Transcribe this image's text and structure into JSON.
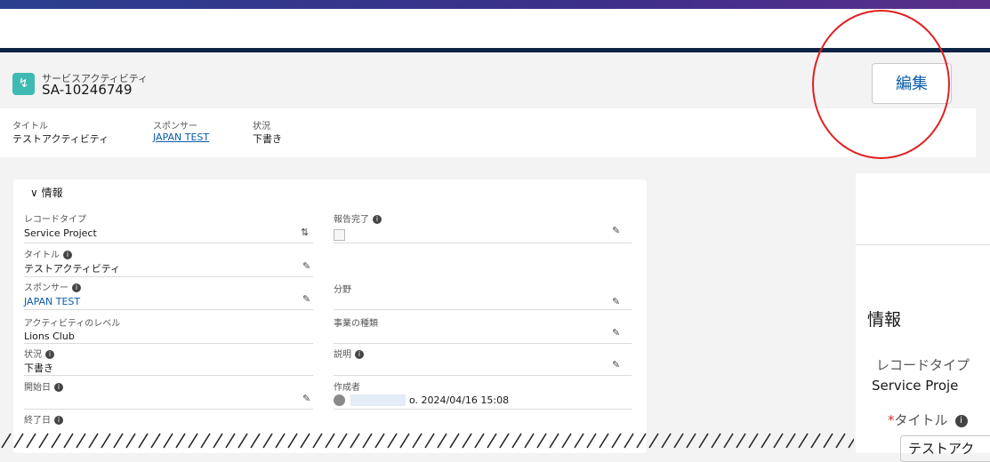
{
  "header": {
    "object_type": "サービスアクティビティ",
    "record_name": "SA-10246749",
    "fields": [
      {
        "label": "タイトル",
        "value": "テストアクティビティ"
      },
      {
        "label": "スポンサー",
        "value": "JAPAN TEST"
      },
      {
        "label": "状況",
        "value": "下書き"
      }
    ],
    "edit_label": "編集"
  },
  "details": {
    "section_title": "∨ 情報",
    "left": [
      {
        "label": "レコードタイプ",
        "value": "Service Project"
      },
      {
        "label": "タイトル",
        "value": "テストアクティビティ"
      },
      {
        "label": "スポンサー",
        "value": "JAPAN TEST"
      },
      {
        "label": "アクティビティのレベル",
        "value": "Lions Club"
      },
      {
        "label": "状況",
        "value": "下書き"
      },
      {
        "label": "開始日",
        "value": ""
      },
      {
        "label": "終了日",
        "value": ""
      }
    ],
    "right": [
      {
        "label": "報告完了",
        "value": ""
      },
      {
        "label": "分野",
        "value": ""
      },
      {
        "label": "事業の種類",
        "value": ""
      },
      {
        "label": "説明",
        "value": ""
      },
      {
        "label": "作成者",
        "value": "o. 2024/04/16 15:08"
      }
    ]
  },
  "zoom": {
    "section_title": "情報",
    "field1_label": "レコードタイプ",
    "field1_value": "Service Proje",
    "required_mark": "*",
    "field2_label": "タイトル",
    "field2_value": "テストアク"
  },
  "colors": {
    "accent": "#0b5cab",
    "annotation": "#e02020",
    "icon_bg": "#3ebab0"
  }
}
